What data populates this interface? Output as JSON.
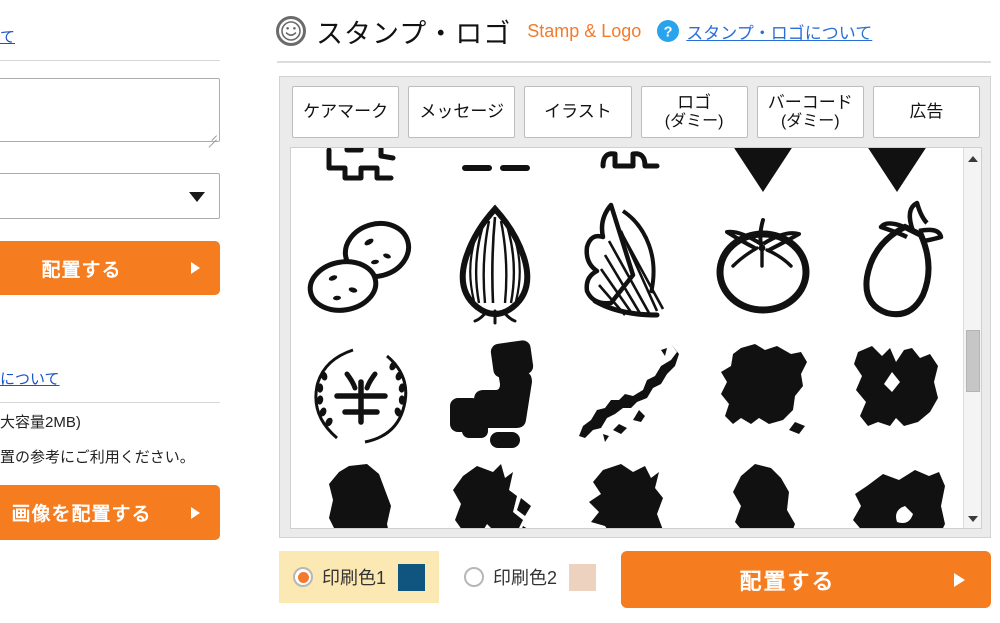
{
  "header": {
    "icon": "smiley-stamp-icon",
    "title": "スタンプ・ロゴ",
    "subtitle": "Stamp & Logo",
    "help_icon": "question-mark-icon",
    "help_link": "スタンプ・ロゴについて"
  },
  "tabs": [
    {
      "line1": "ケアマーク",
      "line2": ""
    },
    {
      "line1": "メッセージ",
      "line2": ""
    },
    {
      "line1": "イラスト",
      "line2": ""
    },
    {
      "line1": "ロゴ",
      "line2": "(ダミー)"
    },
    {
      "line1": "バーコード",
      "line2": "(ダミー)"
    },
    {
      "line1": "広告",
      "line2": ""
    }
  ],
  "gallery": {
    "scrollbar": {
      "up_icon": "scroll-up-arrow-icon",
      "down_icon": "scroll-down-arrow-icon"
    },
    "items": [
      {
        "name": "clipped-outline-shape-a",
        "row": 0,
        "col": 0
      },
      {
        "name": "clipped-outline-shape-b",
        "row": 0,
        "col": 1
      },
      {
        "name": "clipped-outline-shape-c",
        "row": 0,
        "col": 2
      },
      {
        "name": "clipped-solid-triangle-a",
        "row": 0,
        "col": 3
      },
      {
        "name": "clipped-solid-triangle-b",
        "row": 0,
        "col": 4
      },
      {
        "name": "potato-illustration",
        "row": 1,
        "col": 0
      },
      {
        "name": "onion-illustration",
        "row": 1,
        "col": 1
      },
      {
        "name": "leafy-greens-illustration",
        "row": 1,
        "col": 2
      },
      {
        "name": "tomato-illustration",
        "row": 1,
        "col": 3
      },
      {
        "name": "eggplant-illustration",
        "row": 1,
        "col": 4
      },
      {
        "name": "rice-kanji-wreath-illustration",
        "row": 2,
        "col": 0
      },
      {
        "name": "seat-chair-icon",
        "row": 2,
        "col": 1
      },
      {
        "name": "japan-map-silhouette",
        "row": 2,
        "col": 2
      },
      {
        "name": "hokkaido-map-silhouette",
        "row": 2,
        "col": 3
      },
      {
        "name": "aomori-map-silhouette",
        "row": 2,
        "col": 4
      },
      {
        "name": "iwate-map-silhouette",
        "row": 3,
        "col": 0
      },
      {
        "name": "miyagi-map-silhouette",
        "row": 3,
        "col": 1
      },
      {
        "name": "akita-map-silhouette",
        "row": 3,
        "col": 2
      },
      {
        "name": "yamagata-map-silhouette",
        "row": 3,
        "col": 3
      },
      {
        "name": "fukushima-map-silhouette",
        "row": 3,
        "col": 4
      }
    ]
  },
  "bottom": {
    "color1": {
      "label": "印刷色1",
      "selected": true,
      "swatch": "#0f5580"
    },
    "color2": {
      "label": "印刷色2",
      "selected": false,
      "swatch": "#ecd2bf"
    },
    "place_button": {
      "label": "配置する",
      "arrow_icon": "right-arrow-icon"
    }
  },
  "sidebar": {
    "link_top": "て",
    "link_mid": "について",
    "note_1": "大容量2MB)",
    "note_2": "置の参考にご利用ください。",
    "button_top": {
      "label": "配置する",
      "arrow_icon": "right-arrow-icon"
    },
    "button_bottom": {
      "label": "画像を配置する",
      "arrow_icon": "right-arrow-icon"
    },
    "select_caret_icon": "chevron-down-icon",
    "textarea_grip_icon": "resize-grip-icon",
    "textarea_value": "",
    "select_value": ""
  },
  "colors": {
    "accent_orange": "#f57c1f",
    "link_blue": "#2a6ed8",
    "panel_gray": "#ebebeb",
    "highlight_yellow": "#fce8b2"
  }
}
